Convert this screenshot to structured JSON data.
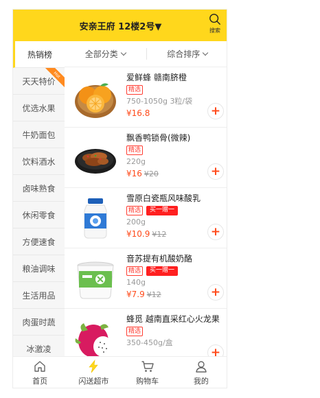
{
  "header": {
    "title": "安亲王府 12楼2号▼",
    "search_label": "搜索"
  },
  "sidebar": {
    "items": [
      {
        "label": "热销榜",
        "active": true
      },
      {
        "label": "天天特价",
        "badge": "Hot"
      },
      {
        "label": "优选水果"
      },
      {
        "label": "牛奶面包"
      },
      {
        "label": "饮料酒水"
      },
      {
        "label": "卤味熟食"
      },
      {
        "label": "休闲零食"
      },
      {
        "label": "方便速食"
      },
      {
        "label": "粮油调味"
      },
      {
        "label": "生活用品"
      },
      {
        "label": "肉蛋时蔬"
      },
      {
        "label": "冰激凌"
      }
    ]
  },
  "filters": {
    "category": "全部分类",
    "sort": "综合排序"
  },
  "products": [
    {
      "name": "爱鲜蜂 赣南脐橙",
      "tag": "精选",
      "promo": "",
      "spec": "750-1050g 3粒/袋",
      "price": "¥16.8",
      "old_price": "",
      "add": "+"
    },
    {
      "name": "飘香鸭锁骨(微辣)",
      "tag": "精选",
      "promo": "",
      "spec": "220g",
      "price": "¥16",
      "old_price": "¥20",
      "add": "+"
    },
    {
      "name": "雪原白瓷瓶风味酸乳",
      "tag": "精选",
      "promo": "买一赠一",
      "spec": "200g",
      "price": "¥10.9",
      "old_price": "¥12",
      "add": "+"
    },
    {
      "name": "音苏提有机酸奶酪",
      "tag": "精选",
      "promo": "买一赠一",
      "spec": "140g",
      "price": "¥7.9",
      "old_price": "¥12",
      "add": "+"
    },
    {
      "name": "蜂觅 越南直采红心火龙果",
      "tag": "精选",
      "promo": "",
      "spec": "350-450g/盒",
      "price": "",
      "old_price": "",
      "add": "+"
    }
  ],
  "tabbar": {
    "items": [
      {
        "label": "首页",
        "icon": "home-icon"
      },
      {
        "label": "闪送超市",
        "icon": "lightning-icon"
      },
      {
        "label": "购物车",
        "icon": "cart-icon"
      },
      {
        "label": "我的",
        "icon": "user-icon"
      }
    ]
  },
  "colors": {
    "brand": "#ffd71c",
    "price": "#ff4a1a",
    "tag": "#ff3b30",
    "hot": "#ff8a1f"
  }
}
